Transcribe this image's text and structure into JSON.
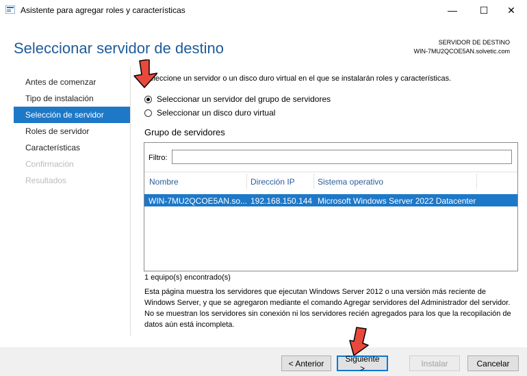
{
  "window": {
    "title": "Asistente para agregar roles y características",
    "minimize_glyph": "—",
    "maximize_glyph": "☐",
    "close_glyph": "✕"
  },
  "header": {
    "page_title": "Seleccionar servidor de destino",
    "destination_label": "SERVIDOR DE DESTINO",
    "destination_value": "WIN-7MU2QCOE5AN.solvetic.com"
  },
  "sidebar": {
    "items": [
      {
        "label": "Antes de comenzar",
        "state": "normal"
      },
      {
        "label": "Tipo de instalación",
        "state": "normal"
      },
      {
        "label": "Selección de servidor",
        "state": "active"
      },
      {
        "label": "Roles de servidor",
        "state": "normal"
      },
      {
        "label": "Características",
        "state": "normal"
      },
      {
        "label": "Confirmación",
        "state": "disabled"
      },
      {
        "label": "Resultados",
        "state": "disabled"
      }
    ]
  },
  "main": {
    "intro": "Seleccione un servidor o un disco duro virtual en el que se instalarán roles y características.",
    "option_pool": "Seleccionar un servidor del grupo de servidores",
    "option_vhd": "Seleccionar un disco duro virtual",
    "selected_option": "pool",
    "group_title": "Grupo de servidores",
    "filter_label": "Filtro:",
    "filter_value": "",
    "columns": [
      "Nombre",
      "Dirección IP",
      "Sistema operativo"
    ],
    "rows": [
      {
        "name": "WIN-7MU2QCOE5AN.so...",
        "ip": "192.168.150.144",
        "os": "Microsoft Windows Server 2022 Datacenter"
      }
    ],
    "found_text": "1 equipo(s) encontrado(s)",
    "description": "Esta página muestra los servidores que ejecutan Windows Server 2012 o una versión más reciente de Windows Server, y que se agregaron mediante el comando Agregar servidores del Administrador del servidor. No se muestran los servidores sin conexión ni los servidores recién agregados para los que la recopilación de datos aún está incompleta."
  },
  "footer": {
    "back_label": "< Anterior",
    "next_label": "Siguiente >",
    "install_label": "Instalar",
    "cancel_label": "Cancelar"
  },
  "colors": {
    "accent": "#1e78c8",
    "title_blue": "#1d5b9a",
    "annotation_arrow": "#e8493a"
  }
}
